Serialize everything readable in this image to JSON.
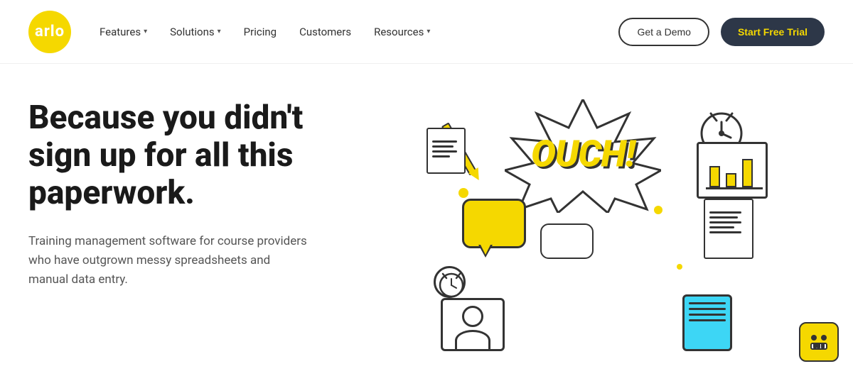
{
  "brand": {
    "logo_text": "arlo",
    "logo_bg": "#F5D800"
  },
  "nav": {
    "items": [
      {
        "label": "Features",
        "has_chevron": true
      },
      {
        "label": "Solutions",
        "has_chevron": true
      },
      {
        "label": "Pricing",
        "has_chevron": false
      },
      {
        "label": "Customers",
        "has_chevron": false
      },
      {
        "label": "Resources",
        "has_chevron": true
      }
    ],
    "cta_demo": "Get a Demo",
    "cta_trial": "Start Free Trial"
  },
  "hero": {
    "title": "Because you didn't sign up for all this paperwork.",
    "subtitle": "Training management software for course providers who have outgrown messy spreadsheets and manual data entry.",
    "illustration_ouch": "OUCH!"
  }
}
